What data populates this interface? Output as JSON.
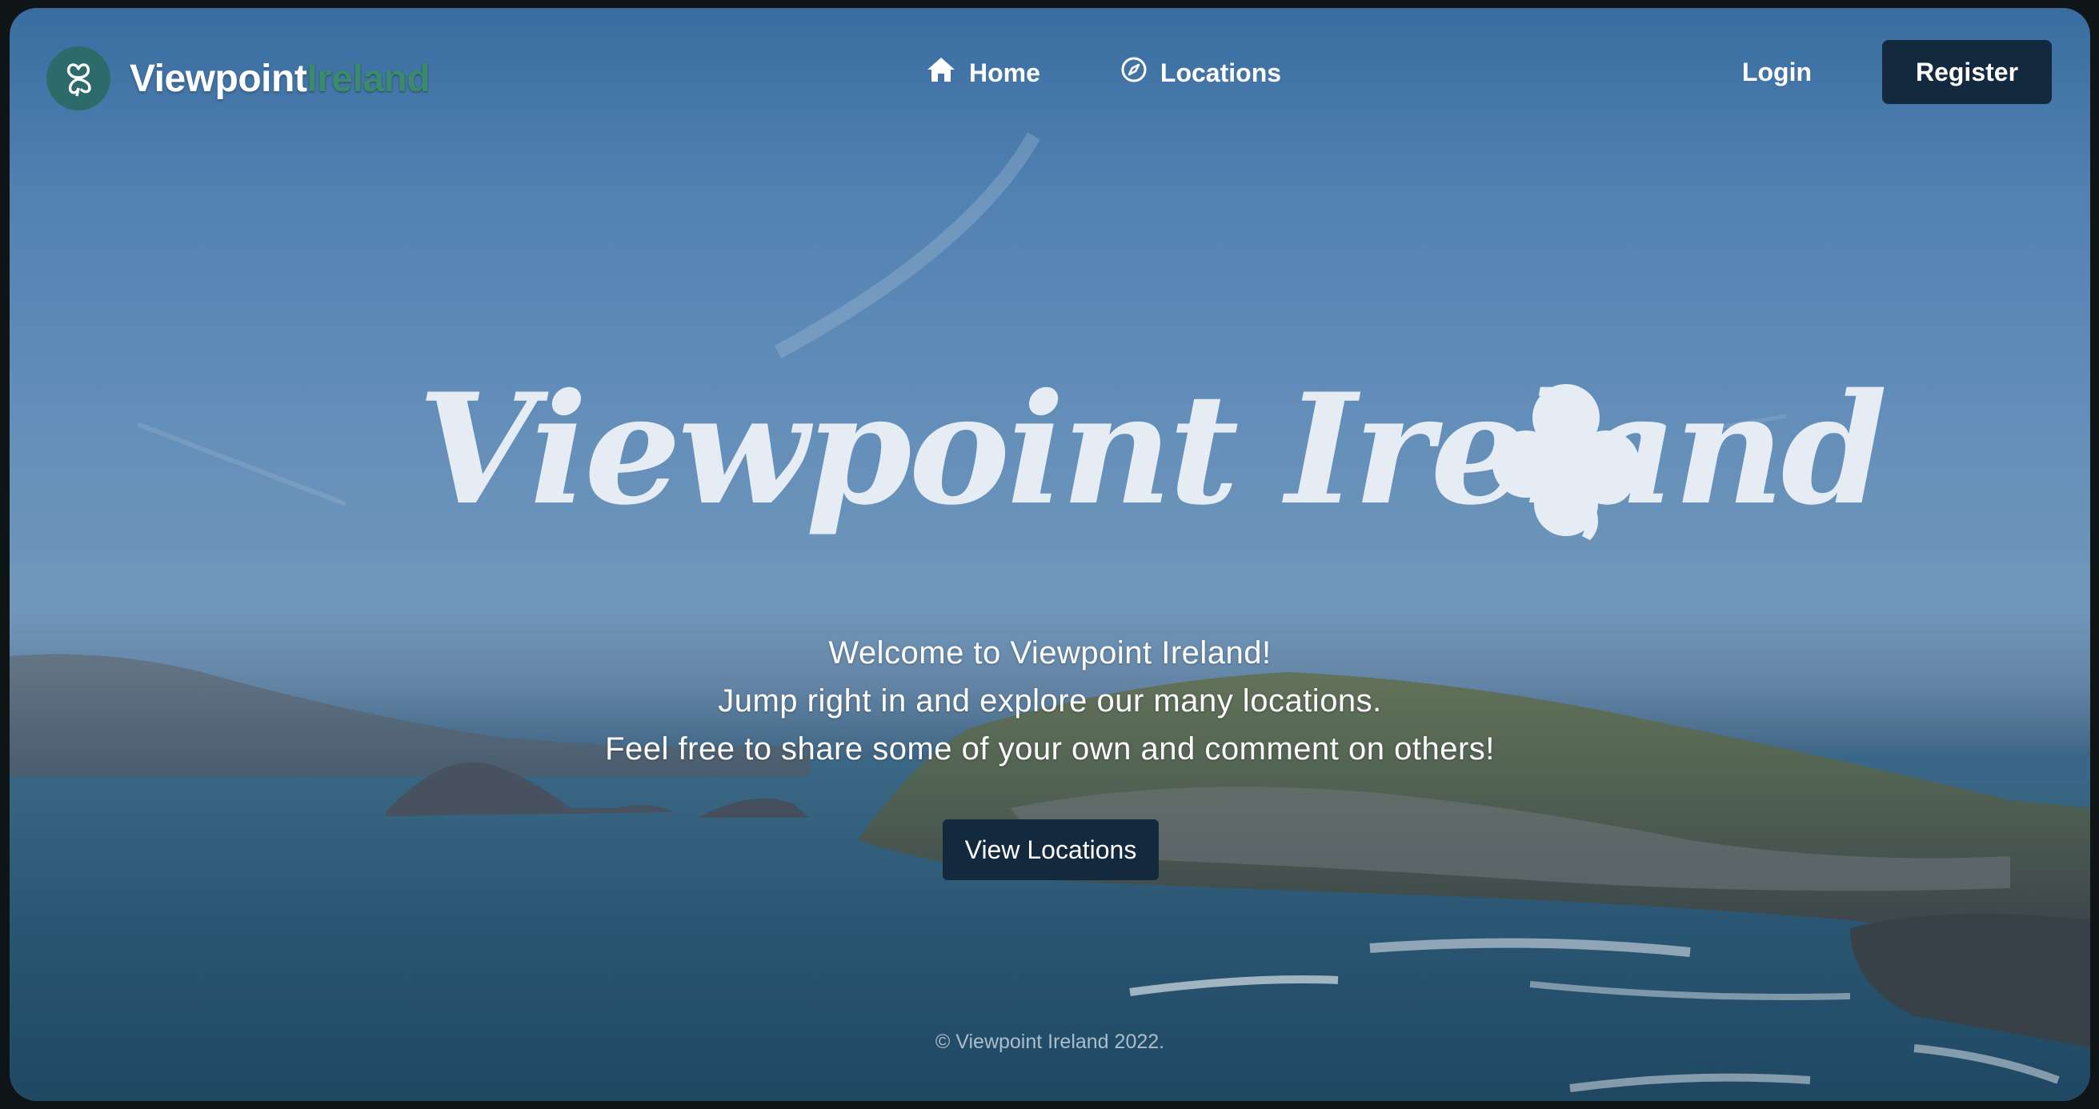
{
  "brand": {
    "name_main": "Viewpoint",
    "name_accent": "Ireland",
    "logo_icon": "shamrock-icon"
  },
  "nav": {
    "items": [
      {
        "label": "Home",
        "icon": "home-icon"
      },
      {
        "label": "Locations",
        "icon": "compass-icon"
      }
    ],
    "login_label": "Login",
    "register_label": "Register"
  },
  "hero": {
    "title": "Viewpoint Ireland",
    "title_icon": "shamrock-icon",
    "lines": [
      "Welcome to Viewpoint Ireland!",
      "Jump right in and explore our many locations.",
      "Feel free to share some of your own and comment on others!"
    ],
    "cta_label": "View Locations"
  },
  "footer": {
    "text": "© Viewpoint Ireland 2022."
  },
  "colors": {
    "brand_accent": "#3b8a6e",
    "button_dark": "#13293d",
    "title_text": "#e6ecf4"
  }
}
